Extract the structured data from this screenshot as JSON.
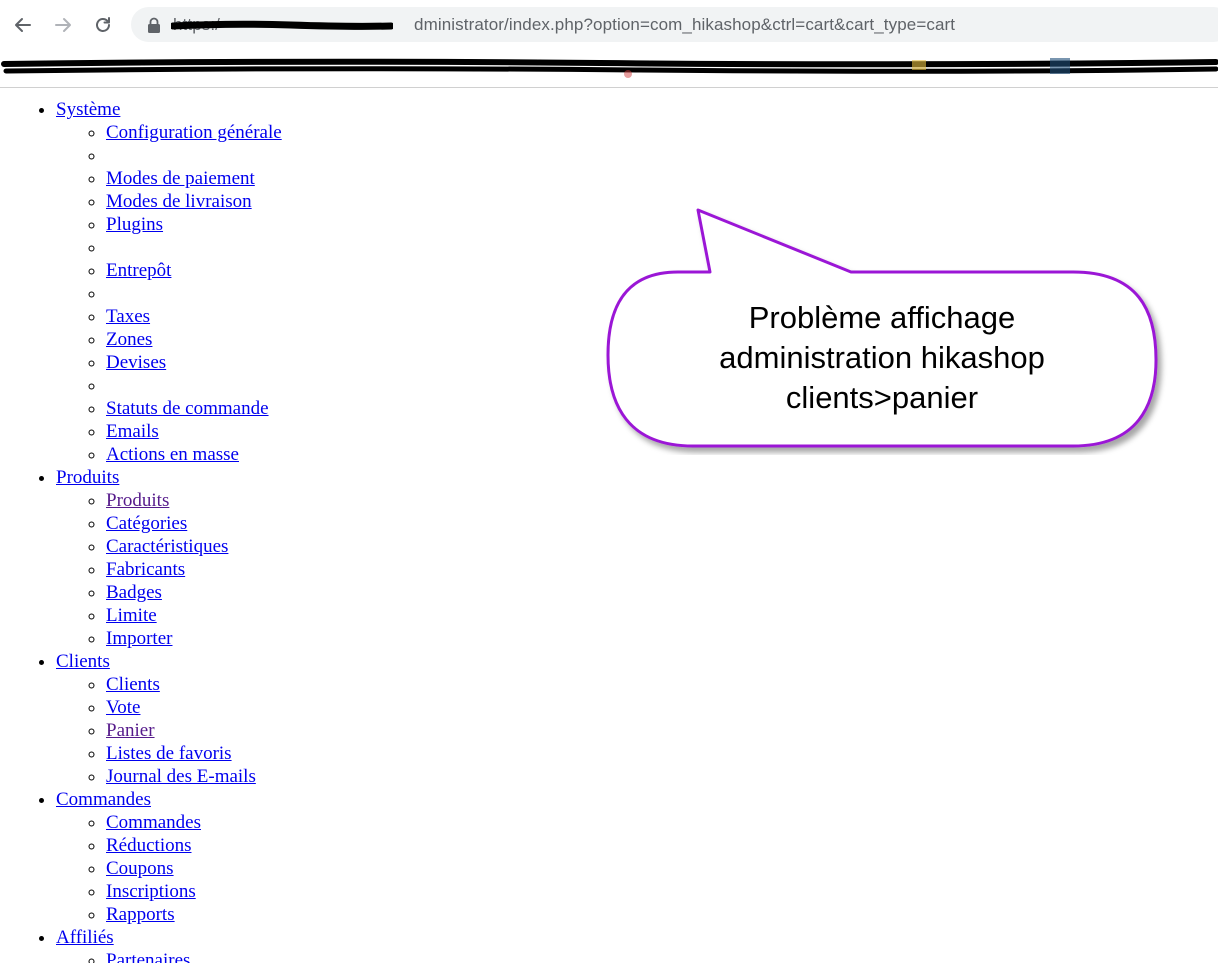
{
  "browser": {
    "url_prefix": "https:/",
    "url_suffix": "dministrator/index.php?option=com_hikashop&ctrl=cart&cart_type=cart",
    "back_icon": "arrow-left-icon",
    "forward_icon": "arrow-right-icon",
    "reload_icon": "reload-icon",
    "lock_icon": "lock-icon"
  },
  "menu": [
    {
      "label": "Système",
      "items": [
        "Configuration générale",
        "",
        "Modes de paiement",
        "Modes de livraison",
        "Plugins",
        "",
        "Entrepôt",
        "",
        "Taxes",
        "Zones",
        "Devises",
        "",
        "Statuts de commande",
        "Emails",
        "Actions en masse"
      ]
    },
    {
      "label": "Produits",
      "items": [
        "Produits",
        "Catégories",
        "Caractéristiques",
        "Fabricants",
        "Badges",
        "Limite",
        "Importer"
      ]
    },
    {
      "label": "Clients",
      "items": [
        "Clients",
        "Vote",
        "Panier",
        "Listes de favoris",
        "Journal des E-mails"
      ]
    },
    {
      "label": "Commandes",
      "items": [
        "Commandes",
        "Réductions",
        "Coupons",
        "Inscriptions",
        "Rapports"
      ]
    },
    {
      "label": "Affiliés",
      "items": [
        "Partenaires"
      ]
    }
  ],
  "callout": {
    "line1": "Problème affichage",
    "line2": "administration hikashop",
    "line3": "clients>panier",
    "border_color": "#9b19d6"
  },
  "colors": {
    "link": "#0000ee",
    "visited": "#551a8b",
    "omnibox_bg": "#f1f3f4"
  }
}
